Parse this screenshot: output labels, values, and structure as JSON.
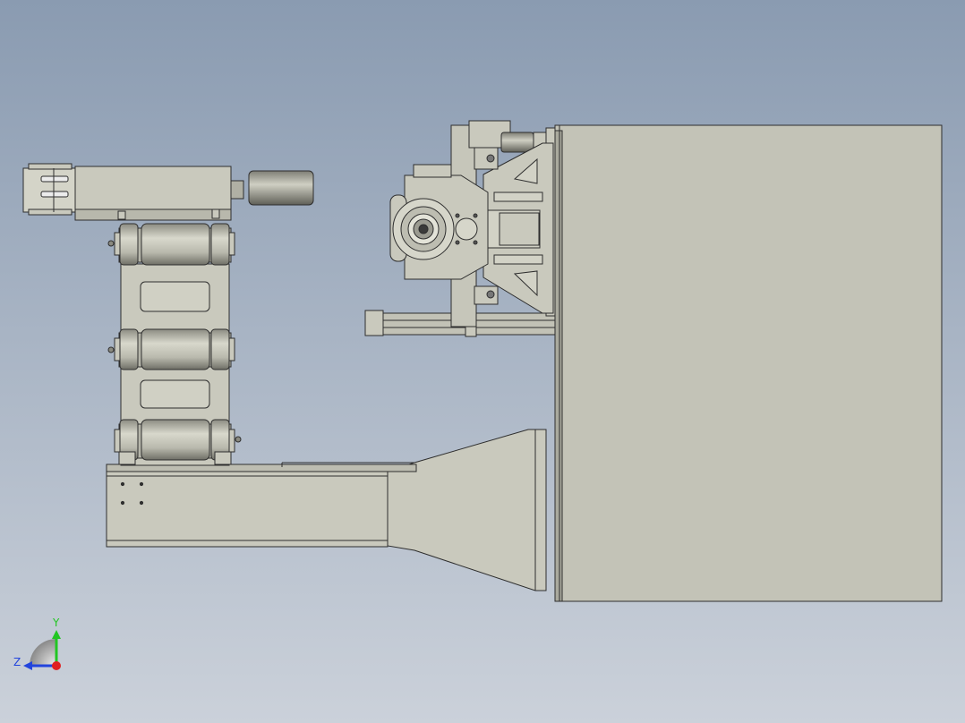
{
  "viewport": {
    "background_top": "#8a9bb1",
    "background_bottom": "#cbd1da"
  },
  "model": {
    "part_color": "#c9c9bd",
    "shadow_color": "#a9a99d",
    "edge_color": "#2e2e2e"
  },
  "triad": {
    "y_label": "Y",
    "z_label": "Z",
    "y_color": "#22c622",
    "z_color": "#2244dd",
    "x_color": "#e02020"
  }
}
